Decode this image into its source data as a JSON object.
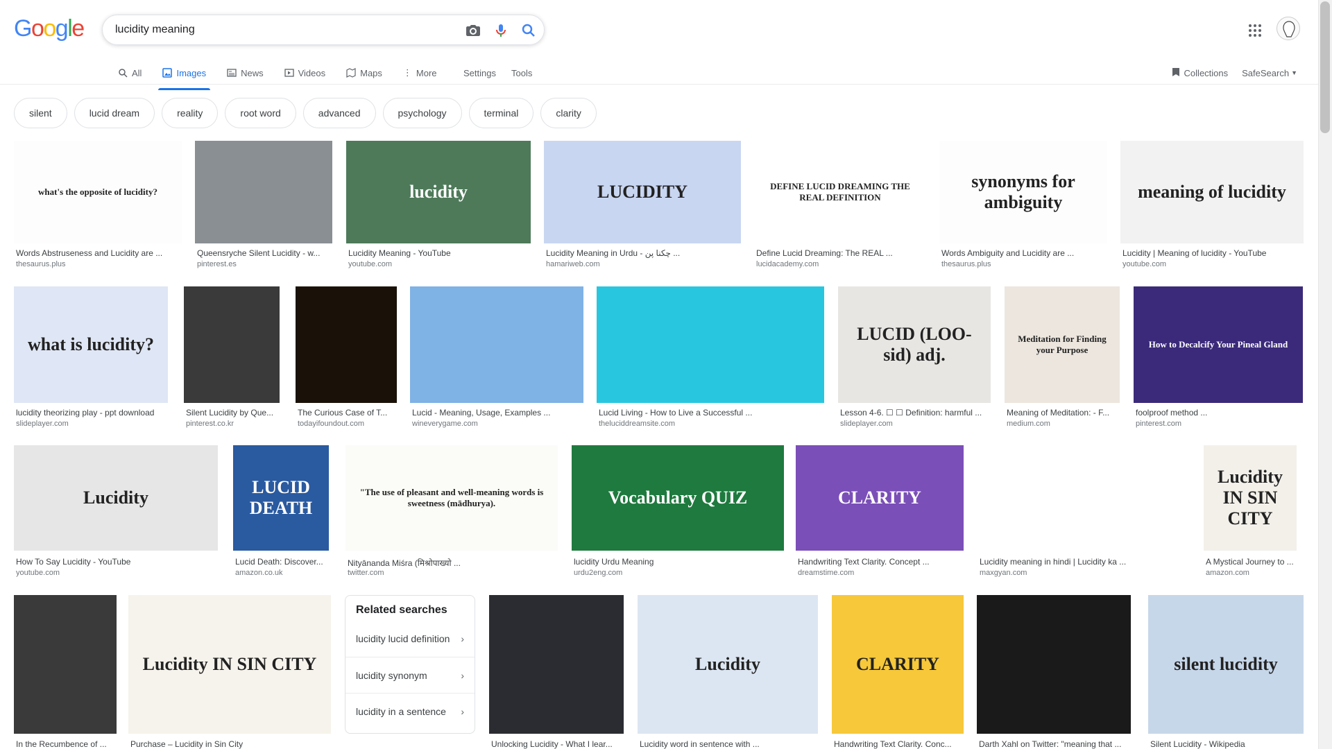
{
  "header": {
    "logo_letters": [
      "G",
      "o",
      "o",
      "g",
      "l",
      "e"
    ],
    "logo_colors": [
      "#4285f4",
      "#ea4335",
      "#fbbc05",
      "#4285f4",
      "#34a853",
      "#ea4335"
    ],
    "search_value": "lucidity meaning",
    "icons": [
      "camera-icon",
      "microphone-icon",
      "search-icon",
      "apps-grid-icon"
    ]
  },
  "tabs": [
    {
      "label": "All",
      "icon": "search-icon",
      "active": false
    },
    {
      "label": "Images",
      "icon": "image-icon",
      "active": true
    },
    {
      "label": "News",
      "icon": "news-icon",
      "active": false
    },
    {
      "label": "Videos",
      "icon": "video-icon",
      "active": false
    },
    {
      "label": "Maps",
      "icon": "map-icon",
      "active": false
    },
    {
      "label": "More",
      "icon": "more-vert-icon",
      "active": false
    }
  ],
  "tools": {
    "settings": "Settings",
    "tools": "Tools"
  },
  "right": {
    "collections": "Collections",
    "safesearch": "SafeSearch"
  },
  "chips": [
    "silent",
    "lucid dream",
    "reality",
    "root word",
    "advanced",
    "psychology",
    "terminal",
    "clarity"
  ],
  "results": [
    {
      "caption": "Words Abstruseness and Lucidity are ...",
      "source": "thesaurus.plus",
      "bg": "#fdfdfd",
      "text": "what's the opposite of lucidity?"
    },
    {
      "caption": "Queensryche Silent Lucidity - w...",
      "source": "pinterest.es",
      "bg": "#8a8f94",
      "text": ""
    },
    {
      "caption": "Lucidity Meaning - YouTube",
      "source": "youtube.com",
      "bg": "#4e7a5a",
      "text": "lucidity"
    },
    {
      "caption": "Lucidity Meaning in Urdu - چکنا پن ...",
      "source": "hamariweb.com",
      "bg": "#c9d6f2",
      "text": "LUCIDITY"
    },
    {
      "caption": "Define Lucid Dreaming: The REAL ...",
      "source": "lucidacademy.com",
      "bg": "#ffffff",
      "text": "DEFINE LUCID DREAMING THE REAL DEFINITION"
    },
    {
      "caption": "Words Ambiguity and Lucidity are ...",
      "source": "thesaurus.plus",
      "bg": "#fdfdfd",
      "text": "synonyms for ambiguity"
    },
    {
      "caption": "Lucidity | Meaning of lucidity - YouTube",
      "source": "youtube.com",
      "bg": "#f2f2f2",
      "text": "meaning of lucidity"
    },
    {
      "caption": "lucidity theorizing play - ppt download",
      "source": "slideplayer.com",
      "bg": "#dfe6f5",
      "text": "what is lucidity?"
    },
    {
      "caption": "Silent Lucidity by Que...",
      "source": "pinterest.co.kr",
      "bg": "#3a3a3a",
      "text": ""
    },
    {
      "caption": "The Curious Case of T...",
      "source": "todayifoundout.com",
      "bg": "#1a1208",
      "text": ""
    },
    {
      "caption": "Lucid - Meaning, Usage, Examples ...",
      "source": "wineverygame.com",
      "bg": "#7fb2e5",
      "text": ""
    },
    {
      "caption": "Lucid Living - How to Live a Successful ...",
      "source": "theluciddreamsite.com",
      "bg": "#29c6e0",
      "text": ""
    },
    {
      "caption": "Lesson 4-6. ☐ ☐ Definition: harmful ...",
      "source": "slideplayer.com",
      "bg": "#e8e6e3",
      "text": "LUCID (LOO-sid) adj."
    },
    {
      "caption": "Meaning of Meditation: - F...",
      "source": "medium.com",
      "bg": "#ece6de",
      "text": "Meditation for Finding your Purpose"
    },
    {
      "caption": "foolproof method ...",
      "source": "pinterest.com",
      "bg": "#3b2a7a",
      "text": "How to Decalcify Your Pineal Gland"
    },
    {
      "caption": "How To Say Lucidity - YouTube",
      "source": "youtube.com",
      "bg": "#e6e6e6",
      "text": "Lucidity"
    },
    {
      "caption": "Lucid Death: Discover...",
      "source": "amazon.co.uk",
      "bg": "#2a5aa0",
      "text": "LUCID DEATH"
    },
    {
      "caption": "Nityānanda Miśra (मिश्रोपाख्यो ...",
      "source": "twitter.com",
      "bg": "#fbfbf7",
      "text": "\"The use of pleasant and well-meaning words is sweetness (mādhurya)."
    },
    {
      "caption": "lucidity Urdu Meaning",
      "source": "urdu2eng.com",
      "bg": "#1e7a3e",
      "text": "Vocabulary QUIZ"
    },
    {
      "caption": "Handwriting Text Clarity. Concept ...",
      "source": "dreamstime.com",
      "bg": "#7b4fb8",
      "text": "CLARITY"
    },
    {
      "caption": "Lucidity meaning in hindi | Lucidity ka ...",
      "source": "maxgyan.com",
      "bg": "#ffffff",
      "text": ""
    },
    {
      "caption": "A Mystical Journey to ...",
      "source": "amazon.com",
      "bg": "#f3f0ea",
      "text": "Lucidity IN SIN CITY"
    },
    {
      "caption": "In the Recumbence of ...",
      "source": "",
      "bg": "#3a3a3a",
      "text": ""
    },
    {
      "caption": "Purchase – Lucidity in Sin City",
      "source": "",
      "bg": "#f6f3ec",
      "text": "Lucidity IN SIN CITY"
    },
    {
      "caption": "Unlocking Lucidity - What I lear...",
      "source": "",
      "bg": "#2b2b32",
      "text": ""
    },
    {
      "caption": "Lucidity word in sentence with ...",
      "source": "",
      "bg": "#dce6f2",
      "text": "Lucidity"
    },
    {
      "caption": "Handwriting Text Clarity. Conc...",
      "source": "",
      "bg": "#f6c83a",
      "text": "CLARITY"
    },
    {
      "caption": "Darth Xahl on Twitter: \"meaning that ...",
      "source": "",
      "bg": "#1a1a1a",
      "text": ""
    },
    {
      "caption": "Silent Lucidity - Wikipedia",
      "source": "",
      "bg": "#c7d7ea",
      "text": "silent lucidity"
    }
  ],
  "related": {
    "title": "Related searches",
    "items": [
      "lucidity lucid definition",
      "lucidity synonym",
      "lucidity in a sentence"
    ]
  }
}
